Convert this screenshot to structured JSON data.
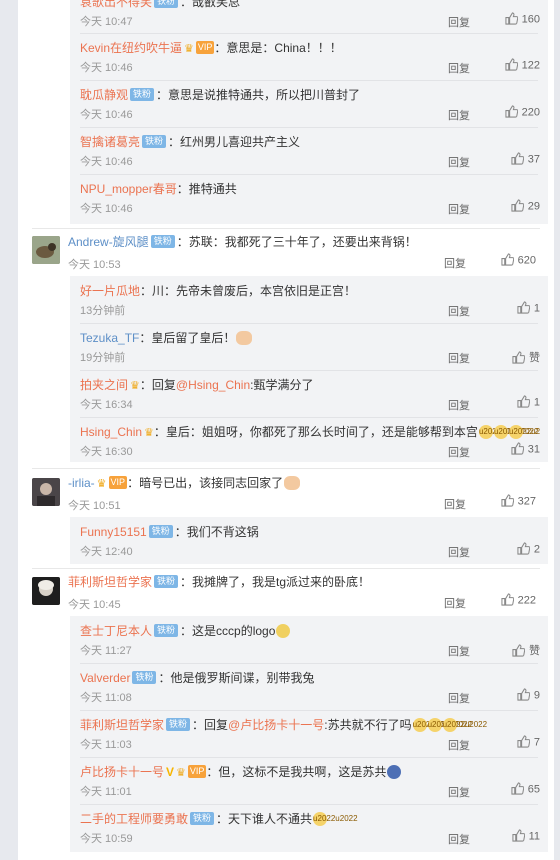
{
  "labels": {
    "reply": "回复",
    "like": "赞",
    "iron_fan": "铁粉"
  },
  "top_partial": {
    "name": "袁歌出不得笑",
    "text": "：哉叡笑总",
    "time": "今天 10:47",
    "likes": "160"
  },
  "group1_subs": [
    {
      "name": "Kevin在纽约吹牛逼",
      "text": "：意思是：China！！！",
      "time": "今天 10:46",
      "likes": "122"
    },
    {
      "name": "耽瓜静观",
      "text": "：意思是说推特通共，所以把川普封了",
      "time": "今天 10:46",
      "likes": "220"
    },
    {
      "name": "智擒诸葛亮",
      "text": "：红州男儿喜迎共产主义",
      "time": "今天 10:46",
      "likes": "37"
    },
    {
      "name": "NPU_mopper春哥",
      "text": "：推特通共",
      "time": "今天 10:46",
      "likes": "29"
    }
  ],
  "comment2": {
    "name": "Andrew-旋风腿",
    "text": "：苏联：我都死了三十年了，还要出来背锅！",
    "time": "今天 10:53",
    "likes": "620",
    "subs": [
      {
        "name": "好一片瓜地",
        "text": "：川：先帝未曾废后，本宫依旧是正宫！",
        "time": "13分钟前",
        "likes": "1"
      },
      {
        "name": "Tezuka_TF",
        "text": "：皇后留了皇后！",
        "time": "19分钟前",
        "likes": "赞"
      },
      {
        "name": "拍夹之间",
        "text": "：回复",
        "mention": "@Hsing_Chin",
        "text2": ":甄学满分了",
        "time": "今天 16:34",
        "likes": "1"
      },
      {
        "name": "Hsing_Chin",
        "text": "：皇后：姐姐呀，你都死了那么长时间了，还是能够帮到本宫",
        "time": "今天 16:30",
        "likes": "31"
      }
    ]
  },
  "comment3": {
    "name": "-irlia-",
    "text": "：暗号已出，该接同志回家了",
    "time": "今天 10:51",
    "likes": "327",
    "subs": [
      {
        "name": "Funny15151",
        "text": "：我们不背这锅",
        "time": "今天 12:40",
        "likes": "2"
      }
    ]
  },
  "comment4": {
    "name": "菲利斯坦哲学家",
    "text": "：我摊牌了，我是tg派过来的卧底！",
    "time": "今天 10:45",
    "likes": "222",
    "subs": [
      {
        "name": "查士丁尼本人",
        "text": "：这是cccp的logo",
        "time": "今天 11:27",
        "likes": "赞"
      },
      {
        "name": "Valverder",
        "text": "：他是俄罗斯间谍，别带我兔",
        "time": "今天 11:08",
        "likes": "9"
      },
      {
        "name": "菲利斯坦哲学家",
        "text": "：回复",
        "mention": "@卢比扬卡十一号",
        "text2": ":苏共就不行了吗",
        "time": "今天 11:03",
        "likes": "7"
      },
      {
        "name": "卢比扬卡十一号",
        "text": "：但，这标不是我共啊，这是苏共",
        "time": "今天 11:01",
        "likes": "65"
      },
      {
        "name": "二手的工程师要勇敢",
        "text": "：天下谁人不通共",
        "time": "今天 10:59",
        "likes": "11"
      }
    ]
  },
  "colors": {
    "name": "#eb7350",
    "badge": "#7eb6e6",
    "page_bg": "#e7e9ee"
  }
}
